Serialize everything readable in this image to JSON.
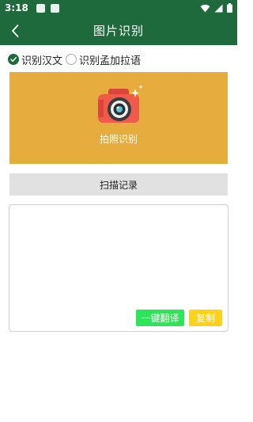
{
  "status_bar": {
    "time": "3:18"
  },
  "app_bar": {
    "title": "图片识别"
  },
  "options": [
    {
      "label": "识别汉文",
      "selected": true
    },
    {
      "label": "识别孟加拉语",
      "selected": false
    }
  ],
  "camera_panel": {
    "label": "拍照识别",
    "icon": "camera-icon"
  },
  "history_button": {
    "label": "扫描记录"
  },
  "text_area": {
    "value": ""
  },
  "actions": {
    "translate_label": "一键翻译",
    "copy_label": "复制"
  },
  "colors": {
    "primary": "#1e6a3c",
    "panel": "#e6ac3d",
    "translate": "#2ee55a",
    "copy": "#ffd21a"
  }
}
